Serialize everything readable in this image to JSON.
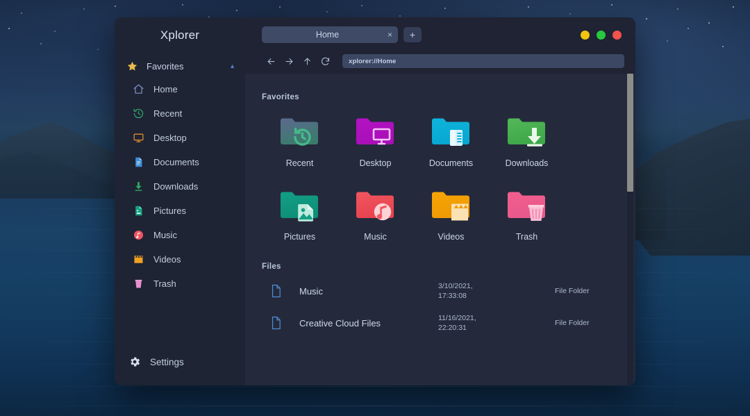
{
  "app": {
    "title": "Xplorer"
  },
  "window_controls": [
    {
      "name": "minimize",
      "color": "#f2c40f"
    },
    {
      "name": "maximize",
      "color": "#27c93f"
    },
    {
      "name": "close",
      "color": "#f0544c"
    }
  ],
  "tabs": {
    "items": [
      {
        "label": "Home",
        "close_label": "×"
      }
    ],
    "new_tab_label": "+"
  },
  "navigation": {
    "back": "←",
    "forward": "→",
    "up": "↑",
    "refresh": "↻",
    "address_value": "xplorer://Home",
    "address_placeholder": "xplorer://"
  },
  "sidebar": {
    "section": {
      "label": "Favorites",
      "icon": "star-icon",
      "caret": "▲"
    },
    "items": [
      {
        "label": "Home",
        "icon": "home-icon"
      },
      {
        "label": "Recent",
        "icon": "recent-clock-icon"
      },
      {
        "label": "Desktop",
        "icon": "desktop-monitor-icon"
      },
      {
        "label": "Documents",
        "icon": "document-icon"
      },
      {
        "label": "Downloads",
        "icon": "download-arrow-icon"
      },
      {
        "label": "Pictures",
        "icon": "picture-icon"
      },
      {
        "label": "Music",
        "icon": "music-note-icon"
      },
      {
        "label": "Videos",
        "icon": "video-clapper-icon"
      },
      {
        "label": "Trash",
        "icon": "trash-icon"
      }
    ],
    "settings": {
      "label": "Settings",
      "icon": "gear-icon"
    }
  },
  "content": {
    "favorites_title": "Favorites",
    "favorites": [
      {
        "label": "Recent",
        "icon": "folder-recent-icon"
      },
      {
        "label": "Desktop",
        "icon": "folder-desktop-icon"
      },
      {
        "label": "Documents",
        "icon": "folder-documents-icon"
      },
      {
        "label": "Downloads",
        "icon": "folder-downloads-icon"
      },
      {
        "label": "Pictures",
        "icon": "folder-pictures-icon"
      },
      {
        "label": "Music",
        "icon": "folder-music-icon"
      },
      {
        "label": "Videos",
        "icon": "folder-videos-icon"
      },
      {
        "label": "Trash",
        "icon": "folder-trash-icon"
      }
    ],
    "files_title": "Files",
    "files": [
      {
        "name": "Music",
        "date": "3/10/2021,",
        "time": "17:33:08",
        "kind": "File Folder",
        "icon": "file-icon"
      },
      {
        "name": "Creative Cloud Files",
        "date": "11/16/2021,",
        "time": "22:20:31",
        "kind": "File Folder",
        "icon": "file-icon"
      }
    ]
  },
  "colors": {
    "sidebar_bg": "#1e2434",
    "content_bg": "#242a3c",
    "header_bg": "#1f2333",
    "tab_active": "#3e4a66",
    "accent": "#4f7fc4",
    "star": "#e9b949"
  }
}
